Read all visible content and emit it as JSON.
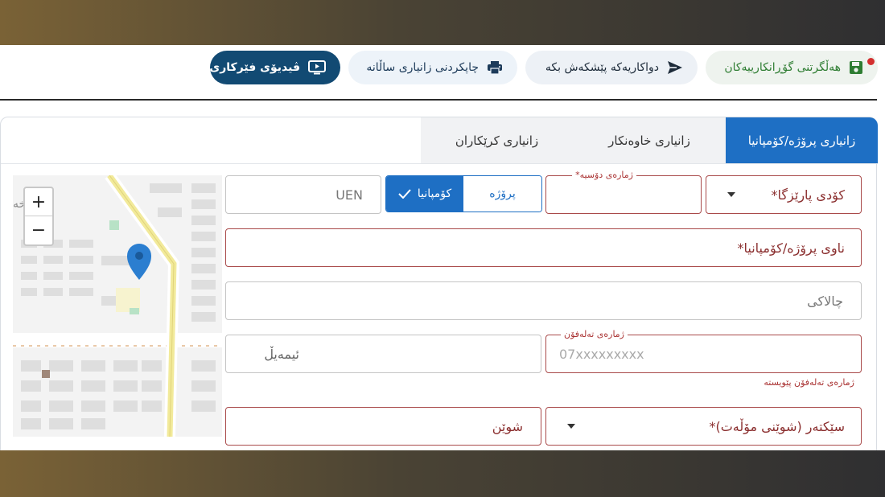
{
  "toolbar": {
    "save_label": "هەڵگرتنی گۆڕانکارییەکان",
    "send_label": "دواکاریەکە پێشکەش بکە",
    "print_label": "چاپکردنی زانیاری ساڵانە",
    "video_label": "ڤیدیۆی فێرکاری"
  },
  "tabs": [
    {
      "label": "زانیاری پرۆژە/کۆمپانیا",
      "active": true
    },
    {
      "label": "زانیاری خاوەنکار",
      "active": false
    },
    {
      "label": "زانیاری کرێکاران",
      "active": false
    }
  ],
  "map": {
    "zoom_in": "+",
    "zoom_out": "−",
    "label_fragment": "خە"
  },
  "form": {
    "province_code": {
      "label": "کۆدی پارێزگا*"
    },
    "file_number": {
      "legend": "ژمارەی دۆسیە*",
      "value": ""
    },
    "entity_type": {
      "option_project": "پرۆژە",
      "option_company": "کۆمپانیا",
      "selected": "کۆمپانیا"
    },
    "uen": {
      "placeholder": "UEN"
    },
    "project_name": {
      "label": "ناوی پرۆژە/کۆمپانیا*"
    },
    "activity": {
      "placeholder": "چالاکی"
    },
    "phone": {
      "legend": "ژمارەی تەلەفۆن",
      "placeholder": "07xxxxxxxxx",
      "helper": "ژمارەی تەلەفۆن پێویستە"
    },
    "email": {
      "placeholder": "ئیمەیڵ"
    },
    "sector": {
      "label": "سێکتەر (شوێنی مۆڵەت)*"
    },
    "location": {
      "label": "شوێن"
    }
  },
  "colors": {
    "accent": "#1e6fc4",
    "video_button": "#124a73",
    "save_text": "#2e7d32",
    "error": "#a33"
  }
}
